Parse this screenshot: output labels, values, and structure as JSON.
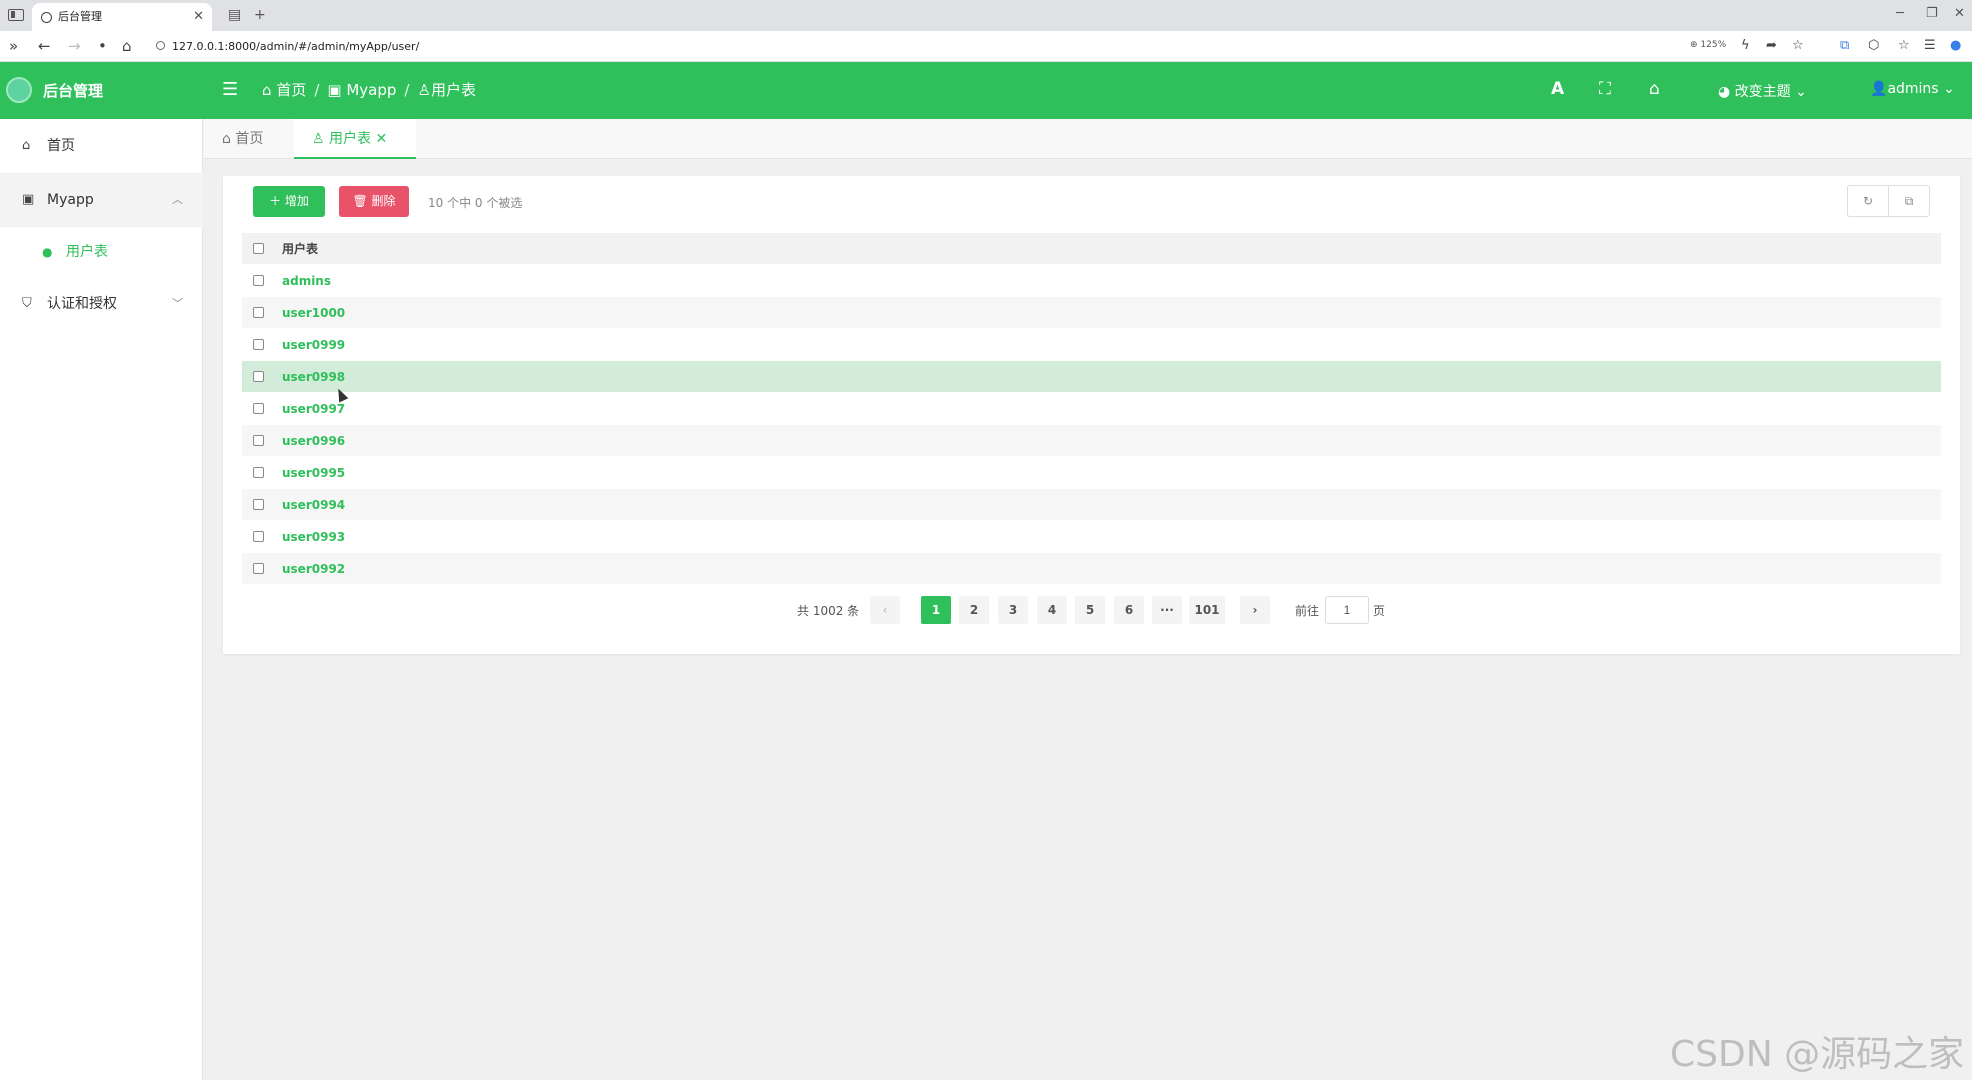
{
  "browser": {
    "tab_title": "后台管理",
    "url": "127.0.0.1:8000/admin/#/admin/myApp/user/",
    "zoom": "125%"
  },
  "header": {
    "app_title": "后台管理",
    "breadcrumb": [
      "首页",
      "Myapp",
      "用户表"
    ],
    "theme_label": "改变主题",
    "user_label": "admins"
  },
  "sidebar": {
    "items": [
      {
        "label": "首页"
      },
      {
        "label": "Myapp"
      },
      {
        "label": "用户表"
      },
      {
        "label": "认证和授权"
      }
    ]
  },
  "page_tabs": [
    {
      "label": "首页"
    },
    {
      "label": "用户表"
    }
  ],
  "toolbar": {
    "add_label": "增加",
    "delete_label": "删除",
    "selection_info": "10 个中 0 个被选"
  },
  "table": {
    "header": "用户表",
    "rows": [
      "admins",
      "user1000",
      "user0999",
      "user0998",
      "user0997",
      "user0996",
      "user0995",
      "user0994",
      "user0993",
      "user0992"
    ]
  },
  "pagination": {
    "total": "共 1002 条",
    "pages": [
      "1",
      "2",
      "3",
      "4",
      "5",
      "6",
      "···",
      "101"
    ],
    "current": "1",
    "goto_label": "前往",
    "goto_value": "1",
    "page_suffix": "页"
  },
  "watermark": "CSDN @源码之家",
  "colors": {
    "primary": "#2fbf5b",
    "danger": "#e9536a",
    "row_hover": "#d3ecd9"
  }
}
